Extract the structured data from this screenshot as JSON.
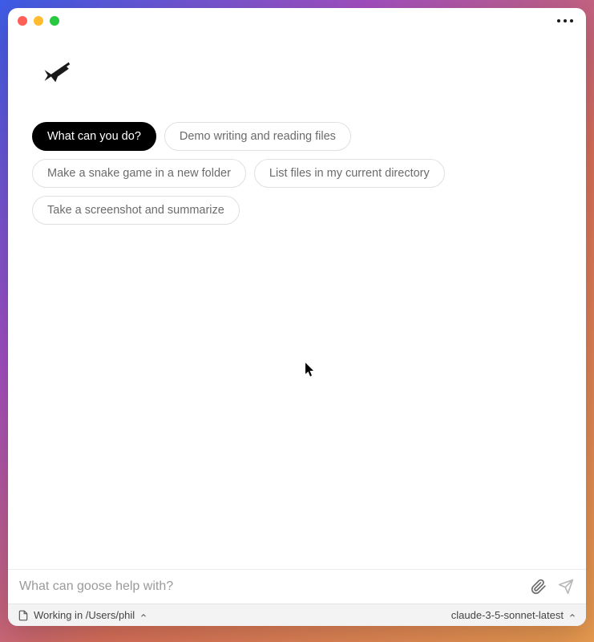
{
  "suggestions": {
    "items": [
      {
        "label": "What can you do?",
        "active": true
      },
      {
        "label": "Demo writing and reading files",
        "active": false
      },
      {
        "label": "Make a snake game in a new folder",
        "active": false
      },
      {
        "label": "List files in my current directory",
        "active": false
      },
      {
        "label": "Take a screenshot and summarize",
        "active": false
      }
    ]
  },
  "input": {
    "placeholder": "What can goose help with?",
    "value": ""
  },
  "status": {
    "working_dir_label": "Working in /Users/phil",
    "model_label": "claude-3-5-sonnet-latest"
  }
}
